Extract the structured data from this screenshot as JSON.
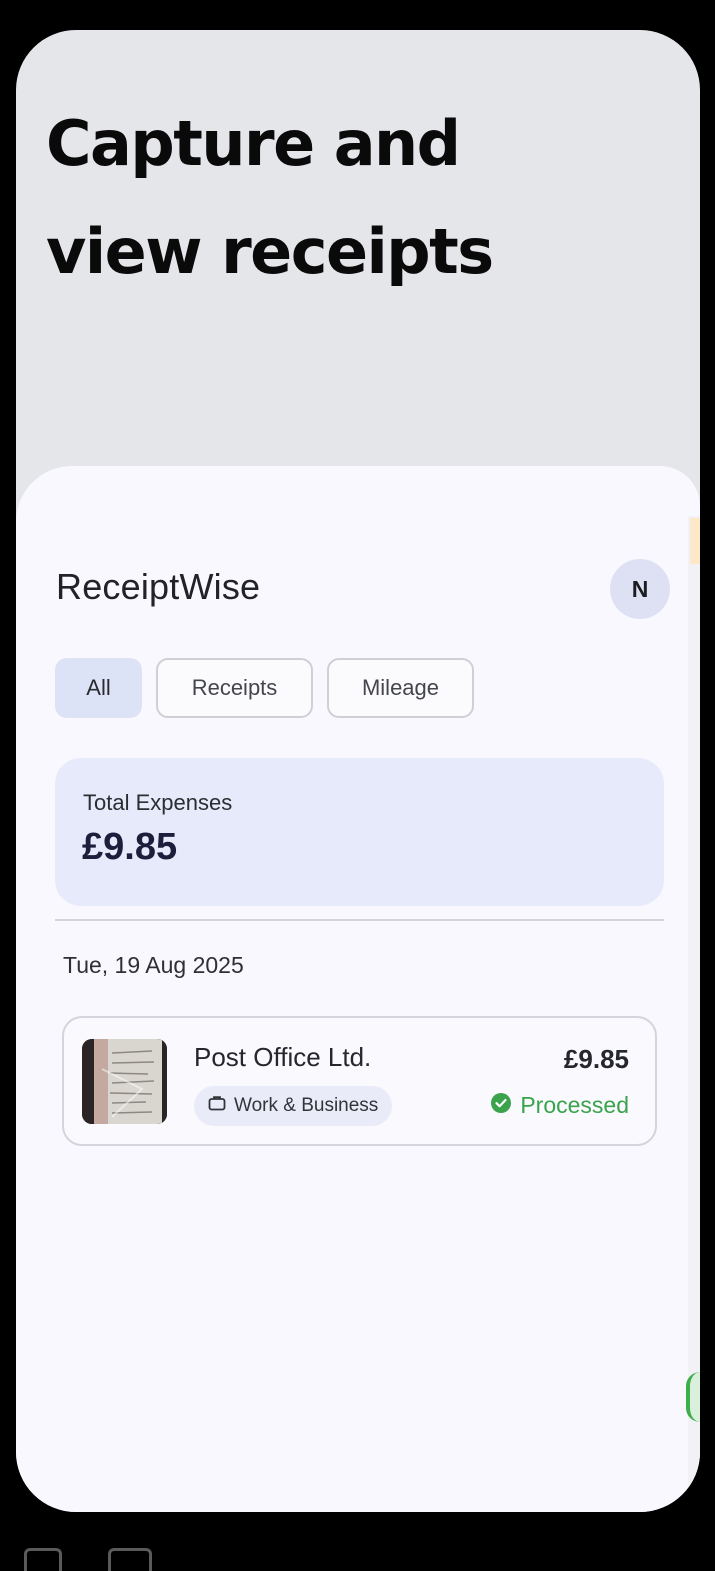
{
  "promo": {
    "headline_line1": "Capture and",
    "headline_line2": "view receipts"
  },
  "app": {
    "title": "ReceiptWise",
    "avatar_initial": "N"
  },
  "tabs": [
    {
      "label": "All",
      "active": true
    },
    {
      "label": "Receipts",
      "active": false
    },
    {
      "label": "Mileage",
      "active": false
    }
  ],
  "summary": {
    "label": "Total Expenses",
    "value": "£9.85"
  },
  "groups": [
    {
      "date": "Tue, 19 Aug 2025",
      "items": [
        {
          "merchant": "Post Office Ltd.",
          "category": "Work & Business",
          "category_icon": "briefcase-icon",
          "amount": "£9.85",
          "status": "Processed",
          "status_icon": "check-circle-icon",
          "status_color": "#3aa34b"
        }
      ]
    }
  ],
  "colors": {
    "accent_tab": "#dde3f6",
    "summary_card": "#e6eafa",
    "processed_green": "#3aa34b"
  }
}
